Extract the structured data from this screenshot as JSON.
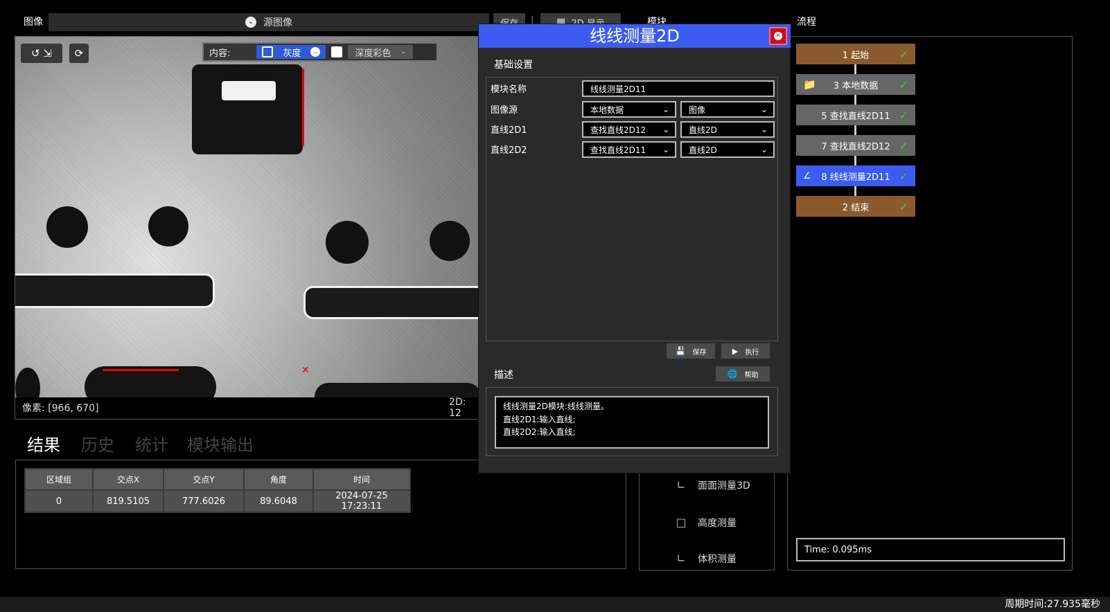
{
  "image_bar": {
    "label": "图像",
    "source": "源图像",
    "save": "保存",
    "display_2d": "2D 显示"
  },
  "viewport": {
    "content_label": "内容:",
    "gray_label": "灰度",
    "depth_color_label": "深度彩色",
    "pixel_readout": "像素: [966, 670]",
    "readout_2d": "2D: 12"
  },
  "tabs": [
    "结果",
    "历史",
    "统计",
    "模块输出"
  ],
  "results": {
    "headers": [
      "区域组",
      "交点X",
      "交点Y",
      "角度",
      "时间"
    ],
    "row": [
      "0",
      "819.5105",
      "777.6026",
      "89.6048",
      "2024-07-25 17:23:11"
    ]
  },
  "modules": {
    "title": "模块",
    "items": [
      {
        "label": "面面测量3D",
        "icon": "face-measure-icon"
      },
      {
        "label": "高度测量",
        "icon": "height-measure-icon"
      },
      {
        "label": "体积测量",
        "icon": "volume-measure-icon"
      }
    ]
  },
  "flow": {
    "title": "流程",
    "nodes": [
      {
        "label": "1 起始",
        "color": "#8a5a2e",
        "icon": ""
      },
      {
        "label": "3 本地数据",
        "color": "#666666",
        "icon": "folder-icon"
      },
      {
        "label": "5 查找直线2D11",
        "color": "#666666",
        "icon": ""
      },
      {
        "label": "7 查找直线2D12",
        "color": "#666666",
        "icon": ""
      },
      {
        "label": "8 线线测量2D11",
        "color": "#3b5cf0",
        "icon": "angle-icon"
      },
      {
        "label": "2 结束",
        "color": "#8a5a2e",
        "icon": ""
      }
    ],
    "time": "Time: 0.095ms"
  },
  "status": {
    "cycle_time": "周期时间:27.935毫秒"
  },
  "dialog": {
    "title": "线线测量2D",
    "basic_settings": "基础设置",
    "fields": {
      "module_name_label": "模块名称",
      "module_name_value": "线线测量2D11",
      "image_source_label": "图像源",
      "image_source_a": "本地数据",
      "image_source_b": "图像",
      "line1_label": "直线2D1",
      "line1_a": "查找直线2D12",
      "line1_b": "直线2D",
      "line2_label": "直线2D2",
      "line2_a": "查找直线2D11",
      "line2_b": "直线2D"
    },
    "save": "保存",
    "execute": "执行",
    "desc_title": "描述",
    "help": "帮助",
    "desc_lines": [
      "线线测量2D模块:线线测量。",
      "直线2D1:输入直线;",
      "直线2D2:输入直线;"
    ]
  }
}
